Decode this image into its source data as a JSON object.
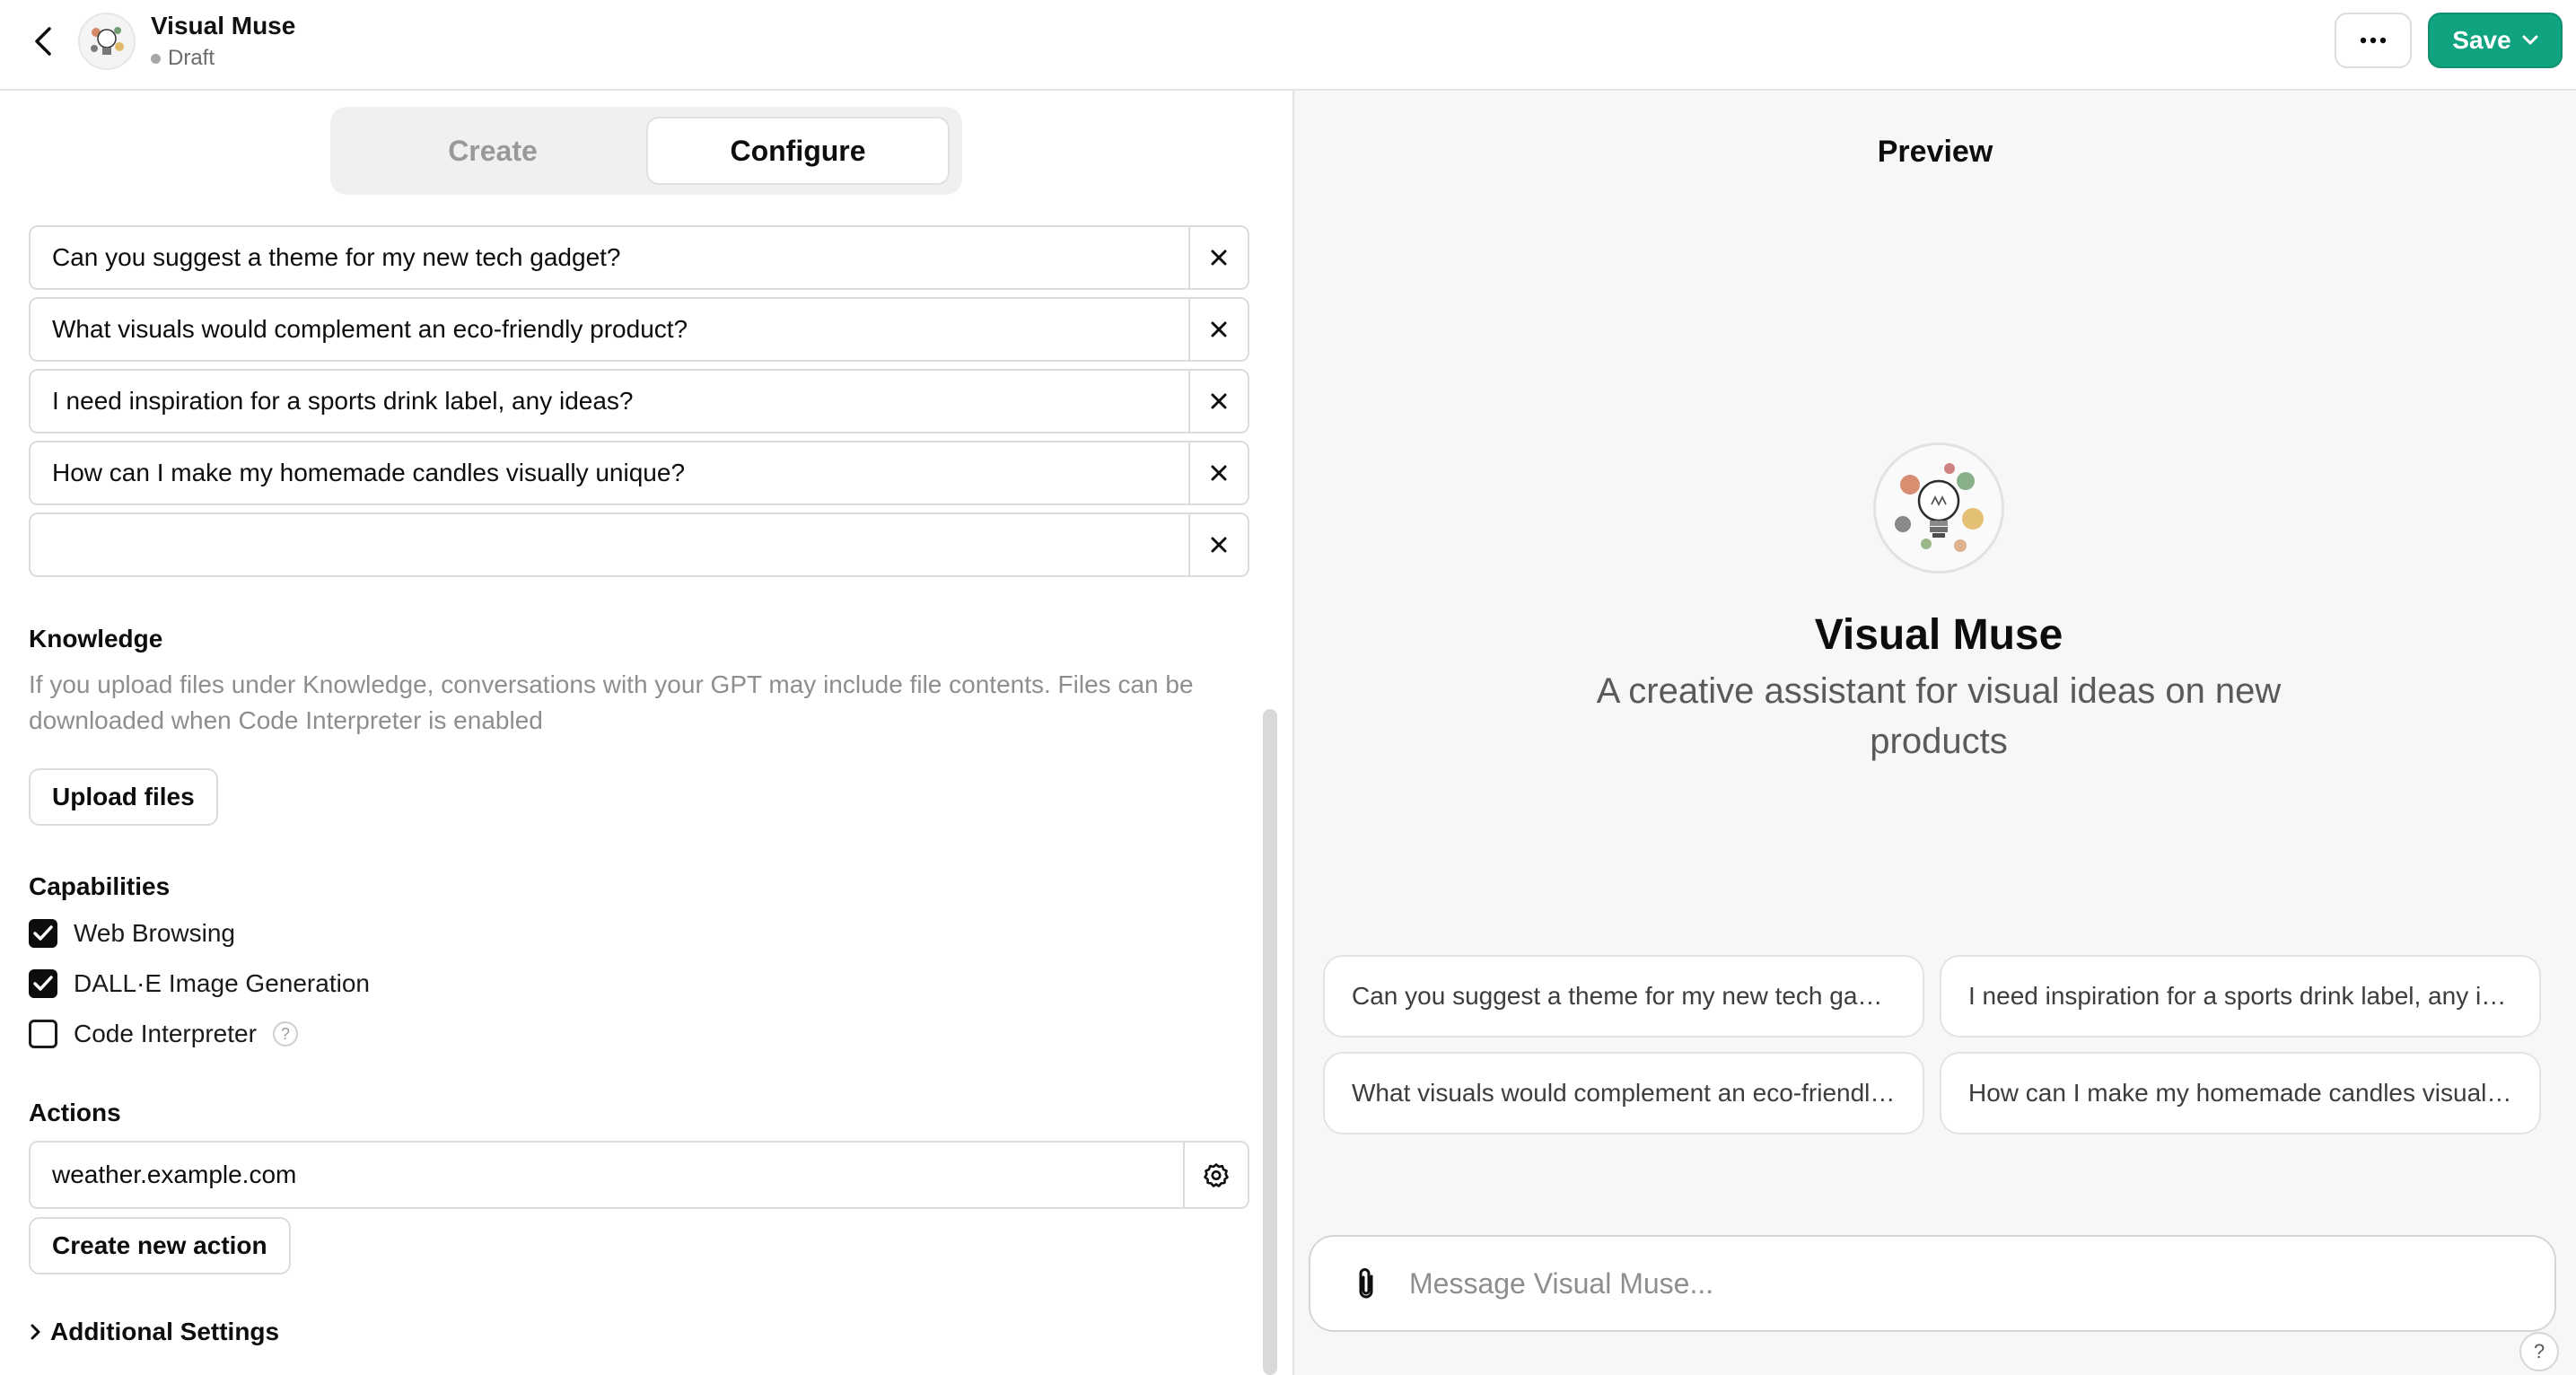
{
  "header": {
    "title": "Visual Muse",
    "status": "Draft",
    "save_label": "Save",
    "back_icon": "chevron-left-icon",
    "more_icon": "ellipsis-icon",
    "accent_color": "#10a37f"
  },
  "tabs": [
    {
      "label": "Create",
      "selected": false
    },
    {
      "label": "Configure",
      "selected": true
    }
  ],
  "conversation_starters": [
    "Can you suggest a theme for my new tech gadget?",
    "What visuals would complement an eco-friendly product?",
    "I need inspiration for a sports drink label, any ideas?",
    "How can I make my homemade candles visually unique?",
    ""
  ],
  "knowledge": {
    "label": "Knowledge",
    "helper": "If you upload files under Knowledge, conversations with your GPT may include file contents. Files can be downloaded when Code Interpreter is enabled",
    "upload_label": "Upload files"
  },
  "capabilities": {
    "label": "Capabilities",
    "items": [
      {
        "label": "Web Browsing",
        "checked": true
      },
      {
        "label": "DALL·E Image Generation",
        "checked": true
      },
      {
        "label": "Code Interpreter",
        "checked": false,
        "help": "?"
      }
    ]
  },
  "actions": {
    "label": "Actions",
    "domain": "weather.example.com",
    "create_label": "Create new action"
  },
  "additional_settings": "Additional Settings",
  "preview": {
    "title": "Preview",
    "name": "Visual Muse",
    "description": "A creative assistant for visual ideas on new products",
    "suggestions": [
      "Can you suggest a theme for my new tech gadget?",
      "I need inspiration for a sports drink label, any ideas?",
      "What visuals would complement an eco-friendly product?",
      "How can I make my homemade candles visually unique?"
    ],
    "composer_placeholder": "Message Visual Muse...",
    "help": "?"
  }
}
